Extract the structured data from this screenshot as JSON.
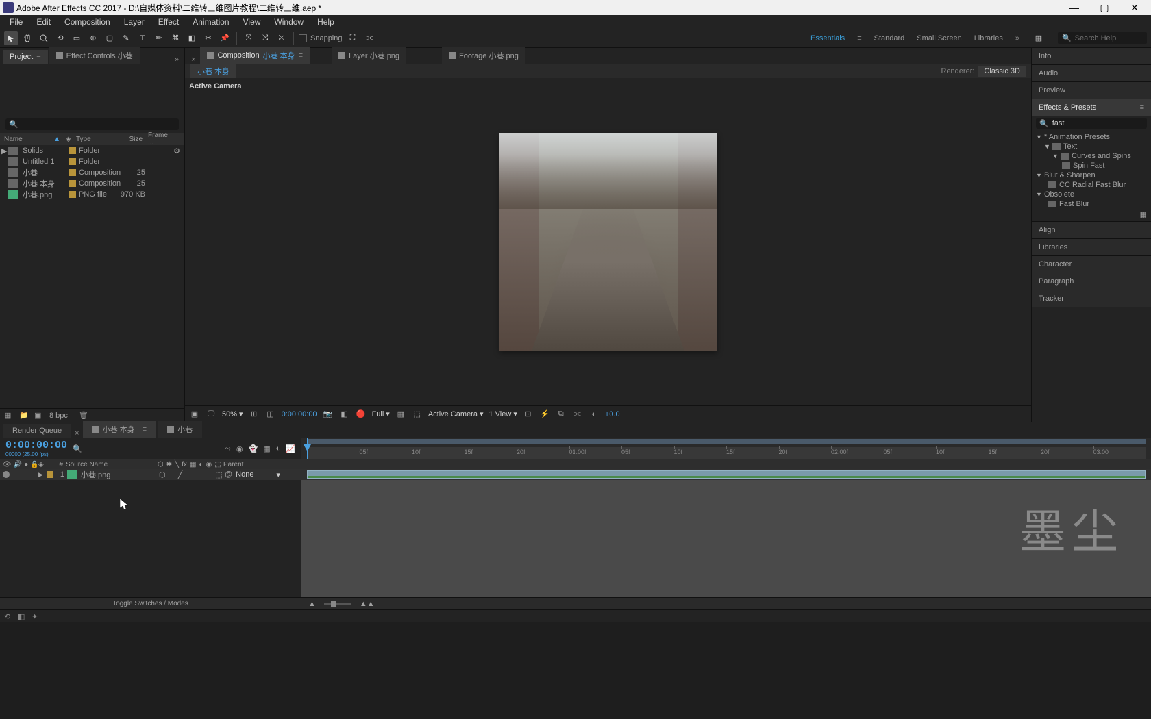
{
  "titlebar": {
    "text": "Adobe After Effects CC 2017 - D:\\自媒体资料\\二维转三维图片教程\\二维转三维.aep *"
  },
  "menu": [
    "File",
    "Edit",
    "Composition",
    "Layer",
    "Effect",
    "Animation",
    "View",
    "Window",
    "Help"
  ],
  "toolbar": {
    "snapping": "Snapping"
  },
  "workspaces": {
    "essentials": "Essentials",
    "standard": "Standard",
    "small_screen": "Small Screen",
    "libraries": "Libraries",
    "search_placeholder": "Search Help"
  },
  "left": {
    "tabs": {
      "project": "Project",
      "effect_controls": "Effect Controls  小巷"
    },
    "columns": {
      "name": "Name",
      "type": "Type",
      "size": "Size",
      "frame": "Frame ..."
    },
    "rows": [
      {
        "name": "Solids",
        "type": "Folder",
        "size": "",
        "icon": "folder",
        "expand": "▶"
      },
      {
        "name": "Untitled 1",
        "type": "Folder",
        "size": "",
        "icon": "folder",
        "expand": ""
      },
      {
        "name": "小巷",
        "type": "Composition",
        "size": "25",
        "icon": "comp",
        "expand": ""
      },
      {
        "name": "小巷 本身",
        "type": "Composition",
        "size": "25",
        "icon": "comp",
        "expand": ""
      },
      {
        "name": "小巷.png",
        "type": "PNG file",
        "size": "970 KB",
        "icon": "png",
        "expand": ""
      }
    ],
    "footer_bpc": "8 bpc"
  },
  "center": {
    "tabs": {
      "composition_prefix": "Composition",
      "composition_name": "小巷 本身",
      "layer": "Layer  小巷.png",
      "footage": "Footage  小巷.png"
    },
    "breadcrumb": "小巷 本身",
    "renderer_label": "Renderer:",
    "renderer_value": "Classic 3D",
    "active_camera": "Active Camera",
    "controls": {
      "zoom": "50%",
      "time": "0:00:00:00",
      "res": "Full",
      "view_type": "Active Camera",
      "views": "1 View",
      "exposure": "+0.0"
    }
  },
  "right": {
    "info": "Info",
    "audio": "Audio",
    "preview": "Preview",
    "effects_presets": "Effects & Presets",
    "search_value": "fast",
    "tree": {
      "root1": "* Animation Presets",
      "text": "Text",
      "curves": "Curves and Spins",
      "spin_fast": "Spin Fast",
      "blur": "Blur & Sharpen",
      "cc_radial": "CC Radial Fast Blur",
      "obsolete": "Obsolete",
      "fast_blur": "Fast Blur"
    },
    "align": "Align",
    "libraries": "Libraries",
    "character": "Character",
    "paragraph": "Paragraph",
    "tracker": "Tracker"
  },
  "timeline": {
    "tabs": {
      "render_queue": "Render Queue",
      "comp1": "小巷 本身",
      "comp2": "小巷"
    },
    "timecode": "0:00:00:00",
    "timecode_sub": "00000 (25.00 fps)",
    "cols": {
      "source": "Source Name",
      "parent": "Parent",
      "num": "#"
    },
    "layer": {
      "num": "1",
      "name": "小巷.png",
      "parent": "None"
    },
    "ticks": [
      "05f",
      "10f",
      "15f",
      "20f",
      "01:00f",
      "05f",
      "10f",
      "15f",
      "20f",
      "02:00f",
      "05f",
      "10f",
      "15f",
      "20f",
      "03:00"
    ],
    "footer": "Toggle Switches / Modes",
    "watermark": "墨尘"
  }
}
